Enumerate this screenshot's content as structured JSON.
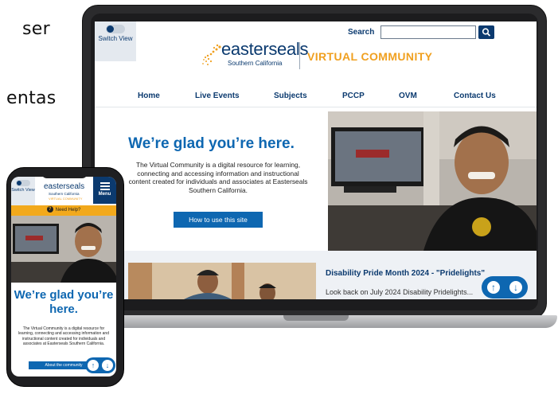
{
  "background_text": {
    "line1": "ser",
    "line2": "entas"
  },
  "desktop": {
    "switch_view_label": "Switch View",
    "search": {
      "label": "Search",
      "placeholder": ""
    },
    "logo": {
      "name": "easterseals",
      "region": "Southern California",
      "tagline": "VIRTUAL COMMUNITY"
    },
    "nav": [
      "Home",
      "Live Events",
      "Subjects",
      "PCCP",
      "OVM",
      "Contact Us"
    ],
    "hero": {
      "title": "We’re glad you’re here.",
      "body": "The Virtual Community is a digital resource for learning, connecting and accessing information and instructional content created for individuals and associates at Easterseals Southern California.",
      "button": "How to use this site"
    },
    "card": {
      "title": "Disability Pride Month 2024 - \"Pridelights\"",
      "text": "Look back on July 2024 Disability Pridelights..."
    },
    "colors": {
      "navy": "#0b3a6f",
      "blue": "#0e67b1",
      "orange": "#f0a020"
    }
  },
  "mobile": {
    "switch_view_label": "Switch View",
    "logo": {
      "name": "easterseals",
      "region": "Southern California",
      "tagline": "VIRTUAL COMMUNITY"
    },
    "menu_label": "Menu",
    "help_label": "Need Help?",
    "hero": {
      "title": "We’re glad you’re here.",
      "body": "The Virtual Community is a digital resource for learning, connecting and accessing information and instructional content created for individuals and associates at Easterseals Southern California.",
      "button": "About the community"
    }
  }
}
